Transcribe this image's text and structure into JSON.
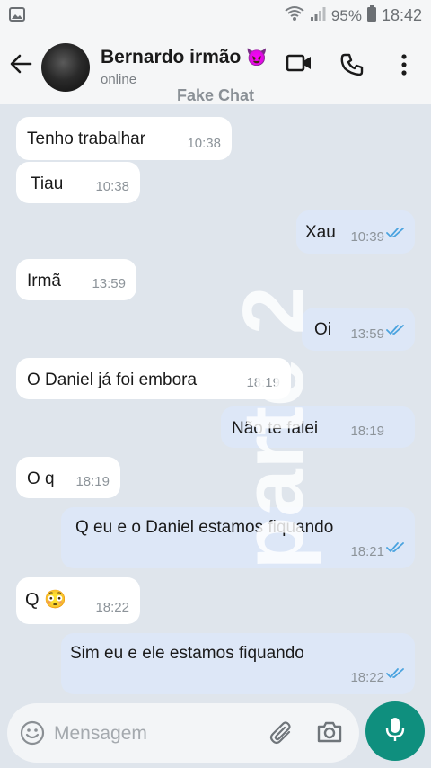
{
  "status_bar": {
    "battery": "95%",
    "time": "18:42"
  },
  "header": {
    "contact_name": "Bernardo irmão",
    "name_emoji": "😈",
    "presence": "online",
    "watermark": "Fake Chat"
  },
  "messages": [
    {
      "dir": "in",
      "text": "Tenho trabalhar",
      "time": "10:38"
    },
    {
      "dir": "in",
      "text": "Tiau",
      "time": "10:38"
    },
    {
      "dir": "out",
      "text": "Xau",
      "time": "10:39",
      "ticks": "read"
    },
    {
      "dir": "in",
      "text": "Irmã",
      "time": "13:59"
    },
    {
      "dir": "out",
      "text": "Oi",
      "time": "13:59",
      "ticks": "read"
    },
    {
      "dir": "in",
      "text": "O  Daniel já foi embora",
      "time": "18:19"
    },
    {
      "dir": "out",
      "text": "Não  te falei",
      "time": "18:19"
    },
    {
      "dir": "in",
      "text": "O q",
      "time": "18:19"
    },
    {
      "dir": "out",
      "text": "Q eu e o Daniel  estamos fiquando",
      "time": "18:21",
      "ticks": "read"
    },
    {
      "dir": "in",
      "text": "Q 😳",
      "time": "18:22"
    },
    {
      "dir": "out",
      "text": "Sim eu e ele estamos fiquando",
      "time": "18:22",
      "ticks": "read"
    }
  ],
  "overlay_text": "parte 2",
  "composer": {
    "placeholder": "Mensagem"
  },
  "colors": {
    "accent": "#0f8f7e",
    "outgoing_bubble": "#dde7f7",
    "incoming_bubble": "#ffffff",
    "read_tick": "#4aa3df"
  },
  "icons": [
    "gallery-icon",
    "wifi-icon",
    "signal-icon",
    "battery-icon",
    "back-arrow-icon",
    "video-call-icon",
    "phone-icon",
    "more-vert-icon",
    "emoji-icon",
    "attach-icon",
    "camera-icon",
    "mic-icon",
    "double-check-icon"
  ]
}
